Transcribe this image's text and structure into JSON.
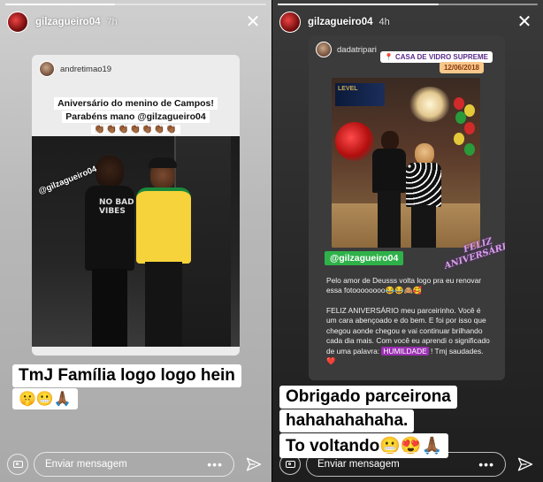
{
  "left_story": {
    "progress": 0.42,
    "username": "gilzagueiro04",
    "time": "7h",
    "shared_post": {
      "username": "andretimao19",
      "caption_line1": "Aniversário do menino de Campos!",
      "caption_line2": "Parabéns mano @gilzagueiro04",
      "claps": "👏🏾👏🏾👏🏾👏🏾👏🏾👏🏾👏🏾",
      "photo_tag": "@gilzagueiro04",
      "shirt_text": "NO BAD VIBES"
    },
    "overlay_text": "TmJ Família logo logo hein",
    "overlay_emojis": "🤫😬🙏🏾",
    "reply_placeholder": "Enviar mensagem",
    "more_label": "•••"
  },
  "right_story": {
    "progress": 0.62,
    "username": "gilzagueiro04",
    "time": "4h",
    "shared_post": {
      "username": "dadatripari",
      "location": "CASA DE VIDRO SUPREME",
      "date": "12/06/2018",
      "photo_sign": "LEVEL",
      "mention_tag": "@gilzagueiro04",
      "sticker": "FELIZ ANIVERSÁRIO!",
      "caption1": "Pelo amor de Deusss volta logo pra eu renovar essa fotoooooooo😂😂🙈🥰",
      "caption2_pre": "FELIZ ANIVERSÁRIO meu parceirinho. Você é um cara abençoado e do bem. E foi por isso que chegou aonde chegou e vai continuar brilhando cada dia mais. Com você eu aprendi o significado de uma palavra: ",
      "caption2_highlight": "HUMILDADE",
      "caption2_post": " ! Tmj saudades. ",
      "caption2_heart": "❤️"
    },
    "overlay_line1": "Obrigado parceirona",
    "overlay_line2": "hahahahahaha.",
    "overlay_line3": "To voltando😬😍🙏🏾",
    "reply_placeholder": "Enviar mensagem",
    "more_label": "•••"
  },
  "colors": {
    "mention_green": "#2fb14a",
    "highlight_purple": "#9b2fb3",
    "date_badge": "#f7c88b"
  }
}
